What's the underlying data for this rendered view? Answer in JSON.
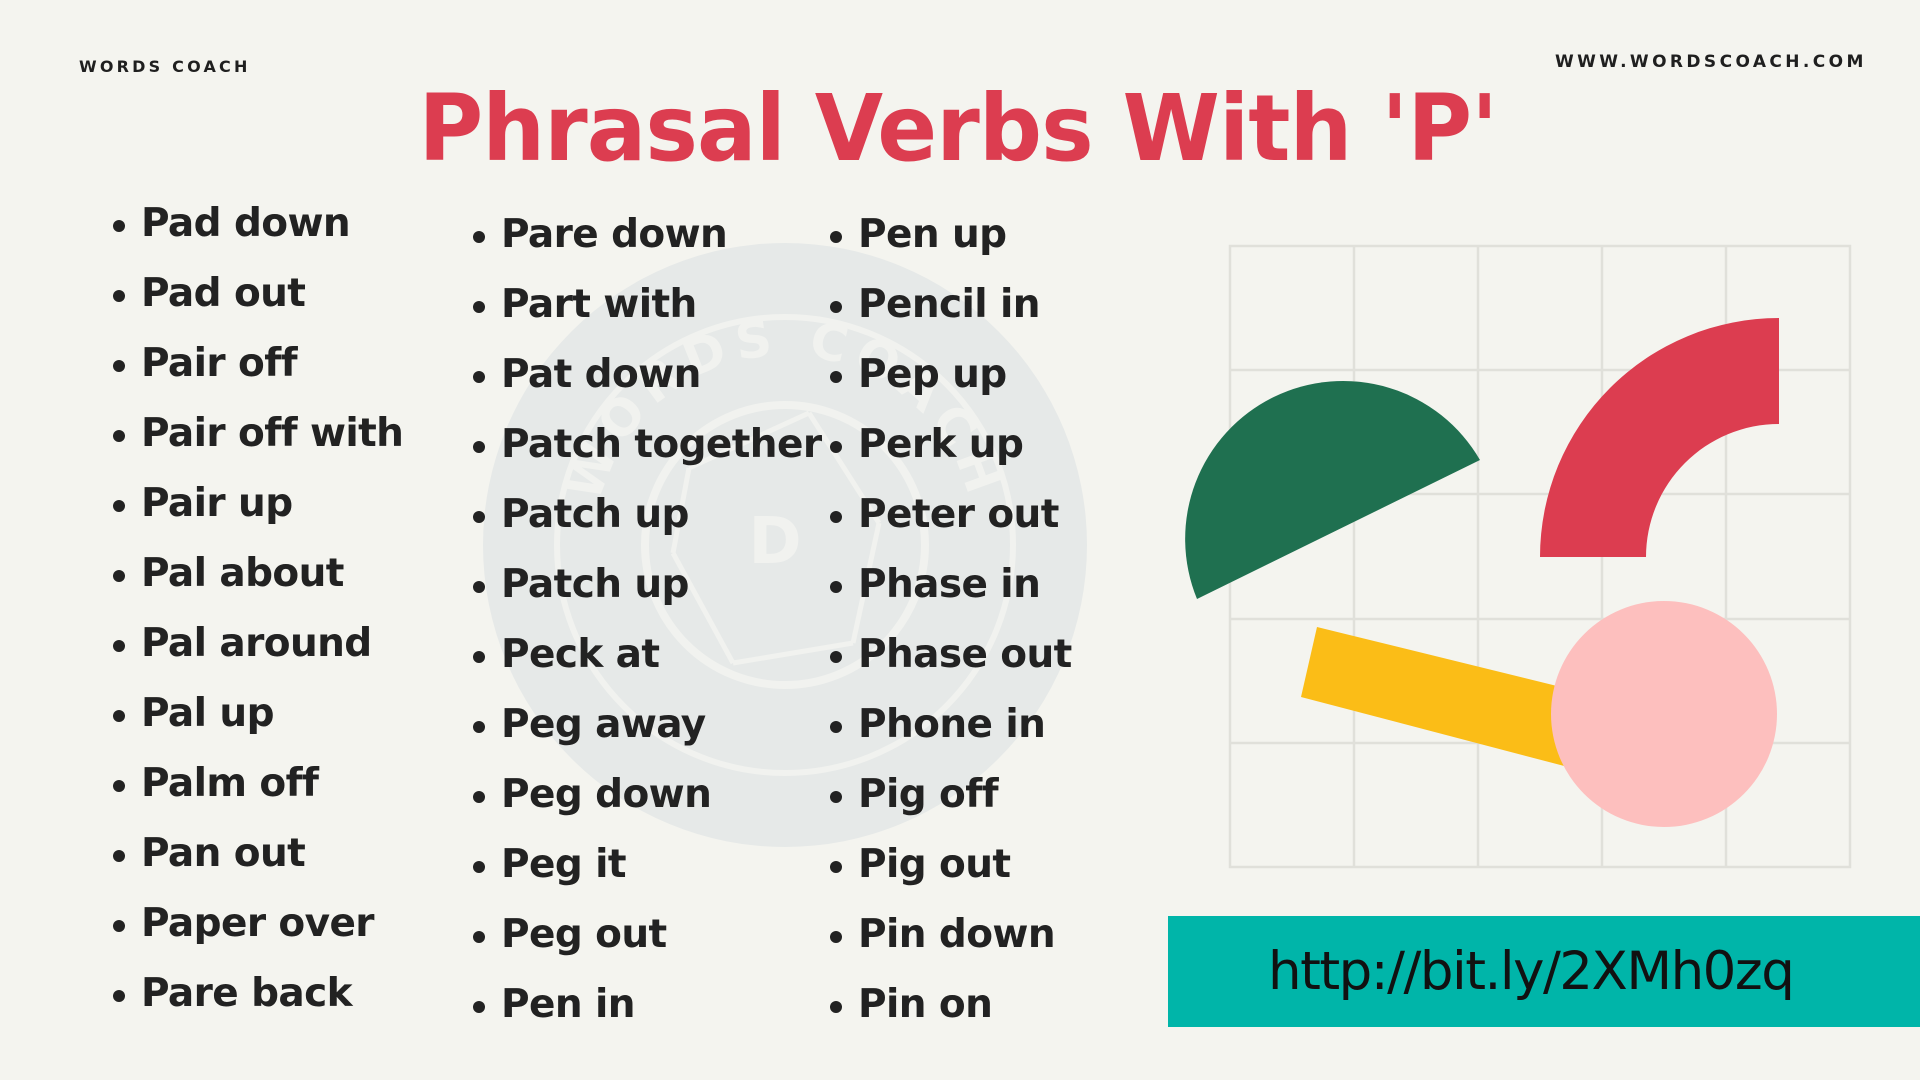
{
  "header": {
    "brand_left": "WORDS COACH",
    "brand_right": "WWW.WORDSCOACH.COM",
    "title": "Phrasal Verbs With 'P'"
  },
  "watermark": {
    "text_top": "WORDS COACH",
    "monogram": "D"
  },
  "columns": [
    {
      "items": [
        "Pad down",
        "Pad out",
        "Pair off",
        "Pair off with",
        "Pair up",
        "Pal about",
        "Pal around",
        "Pal up",
        "Palm off",
        "Pan out",
        "Paper over",
        "Pare back"
      ]
    },
    {
      "items": [
        "Pare down",
        "Part with",
        "Pat down",
        "Patch together",
        "Patch up",
        "Patch up",
        "Peck at",
        "Peg away",
        "Peg down",
        "Peg it",
        "Peg out",
        "Pen in"
      ]
    },
    {
      "items": [
        "Pen up",
        "Pencil in",
        "Pep up",
        "Perk up",
        "Peter out",
        "Phase in",
        "Phase out",
        "Phone in",
        "Pig off",
        "Pig out",
        "Pin down",
        "Pin on"
      ]
    }
  ],
  "decor": {
    "colors": {
      "background": "#f4f4ef",
      "title": "#dc3d50",
      "grid": "#e0e0da",
      "green": "#1f7050",
      "red": "#dc3d50",
      "yellow": "#fbbd17",
      "pink": "#fdbfbe",
      "banner": "#00b5a9",
      "watermark": "#e6e9e8"
    }
  },
  "footer": {
    "link": "http://bit.ly/2XMh0zq"
  }
}
